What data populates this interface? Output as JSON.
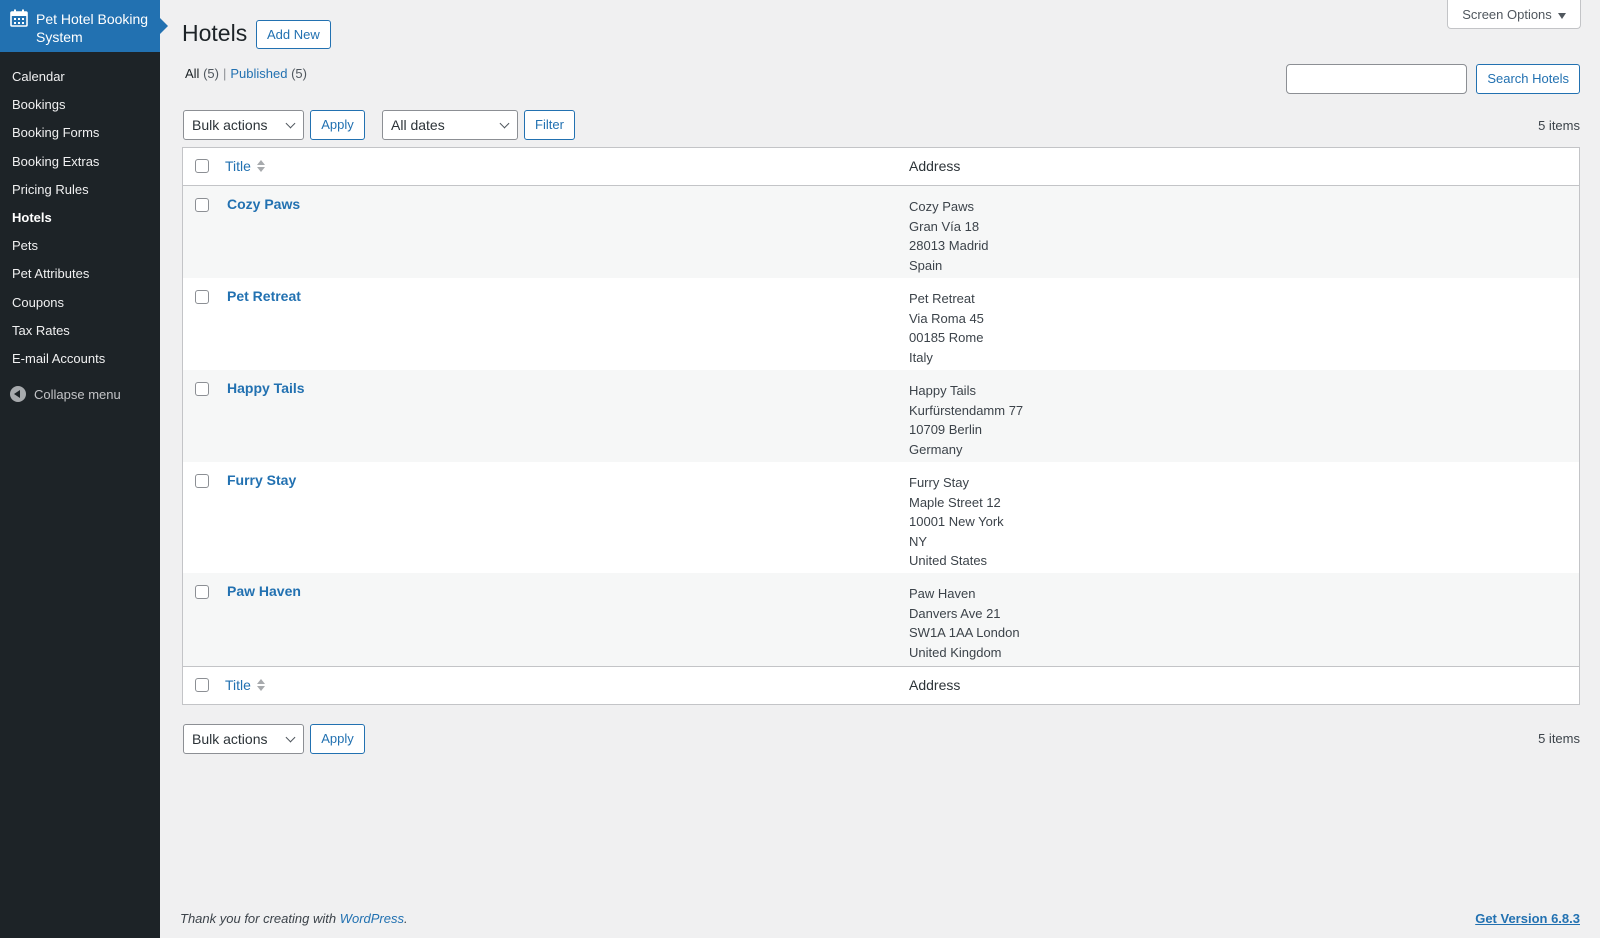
{
  "sidebar": {
    "brand": "Pet Hotel Booking System",
    "items": [
      {
        "label": "Calendar"
      },
      {
        "label": "Bookings"
      },
      {
        "label": "Booking Forms"
      },
      {
        "label": "Booking Extras"
      },
      {
        "label": "Pricing Rules"
      },
      {
        "label": "Hotels",
        "current": true
      },
      {
        "label": "Pets"
      },
      {
        "label": "Pet Attributes"
      },
      {
        "label": "Coupons"
      },
      {
        "label": "Tax Rates"
      },
      {
        "label": "E-mail Accounts"
      }
    ],
    "collapse_label": "Collapse menu"
  },
  "header": {
    "screen_options": "Screen Options",
    "title": "Hotels",
    "add_new": "Add New"
  },
  "views": {
    "all_label": "All",
    "all_count": "(5)",
    "separator": "|",
    "published_label": "Published",
    "published_count": "(5)"
  },
  "search": {
    "value": "",
    "button": "Search Hotels"
  },
  "toolbar_top": {
    "bulk_actions": "Bulk actions",
    "apply": "Apply",
    "dates": "All dates",
    "filter": "Filter",
    "items_count": "5 items"
  },
  "table": {
    "col_title": "Title",
    "col_address": "Address",
    "rows": [
      {
        "name": "Cozy Paws",
        "address": [
          "Cozy Paws",
          "Gran Vía 18",
          "28013 Madrid",
          "Spain"
        ]
      },
      {
        "name": "Pet Retreat",
        "address": [
          "Pet Retreat",
          "Via Roma 45",
          "00185 Rome",
          "Italy"
        ]
      },
      {
        "name": "Happy Tails",
        "address": [
          "Happy Tails",
          "Kurfürstendamm 77",
          "10709 Berlin",
          "Germany"
        ]
      },
      {
        "name": "Furry Stay",
        "address": [
          "Furry Stay",
          "Maple Street 12",
          "10001 New York",
          "NY",
          "United States"
        ]
      },
      {
        "name": "Paw Haven",
        "address": [
          "Paw Haven",
          "Danvers Ave 21",
          "SW1A 1AA London",
          "United Kingdom"
        ]
      }
    ]
  },
  "toolbar_bottom": {
    "bulk_actions": "Bulk actions",
    "apply": "Apply",
    "items_count": "5 items"
  },
  "footer": {
    "thanks_prefix": "Thank you for creating with ",
    "wordpress": "WordPress",
    "thanks_suffix": ".",
    "version": "Get Version 6.8.3"
  },
  "colors": {
    "accent": "#2271b1",
    "sidebar": "#1d2327",
    "background": "#f0f0f1"
  }
}
